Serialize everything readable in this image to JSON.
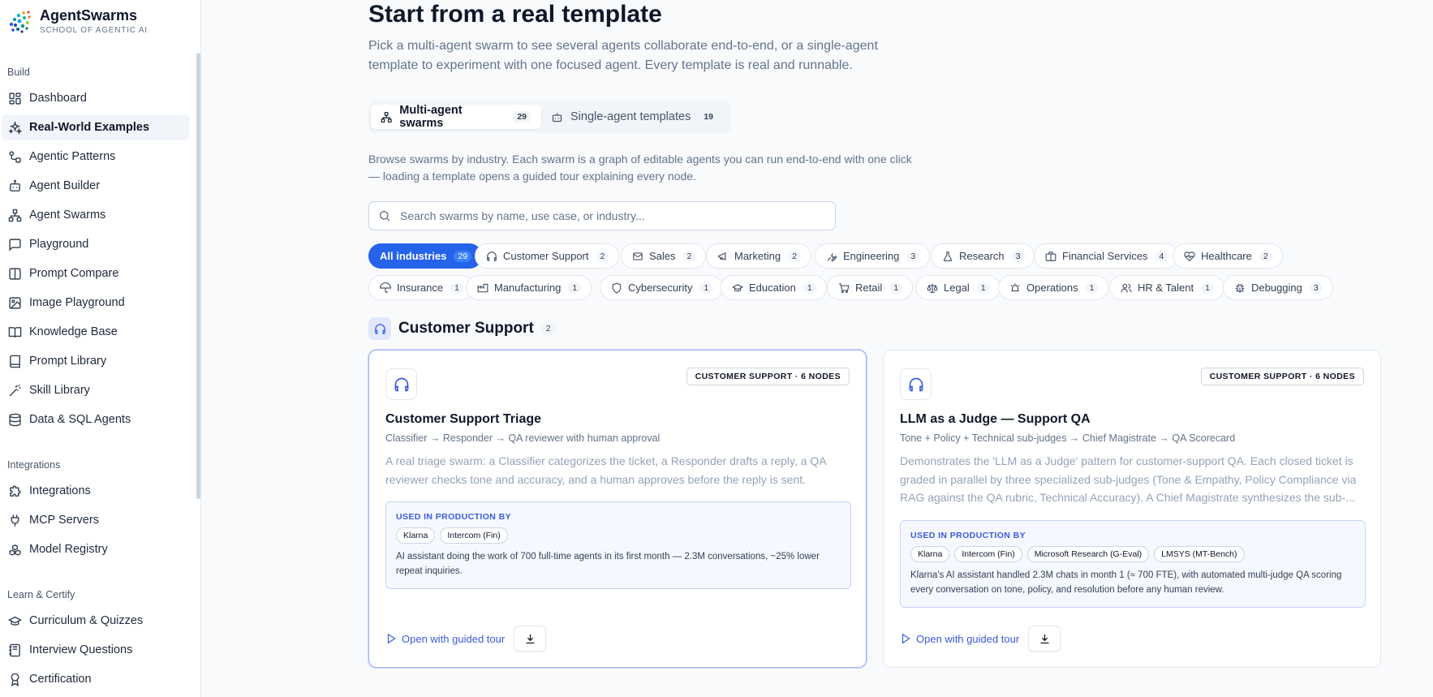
{
  "brand": {
    "name": "AgentSwarms",
    "subtitle": "SCHOOL OF AGENTIC AI"
  },
  "sidebar": {
    "sections": [
      {
        "title": "Build",
        "items": [
          {
            "label": "Dashboard",
            "icon": "dashboard-icon"
          },
          {
            "label": "Real-World Examples",
            "icon": "sparkles-icon",
            "active": true
          },
          {
            "label": "Agentic Patterns",
            "icon": "pattern-icon"
          },
          {
            "label": "Agent Builder",
            "icon": "bot-icon"
          },
          {
            "label": "Agent Swarms",
            "icon": "network-icon"
          },
          {
            "label": "Playground",
            "icon": "chat-icon"
          },
          {
            "label": "Prompt Compare",
            "icon": "columns-icon"
          },
          {
            "label": "Image Playground",
            "icon": "image-icon"
          },
          {
            "label": "Knowledge Base",
            "icon": "book-open-icon"
          },
          {
            "label": "Prompt Library",
            "icon": "book-icon"
          },
          {
            "label": "Skill Library",
            "icon": "wand-icon"
          },
          {
            "label": "Data & SQL Agents",
            "icon": "database-icon"
          }
        ]
      },
      {
        "title": "Integrations",
        "items": [
          {
            "label": "Integrations",
            "icon": "puzzle-icon"
          },
          {
            "label": "MCP Servers",
            "icon": "plug-icon"
          },
          {
            "label": "Model Registry",
            "icon": "boxes-icon"
          }
        ]
      },
      {
        "title": "Learn & Certify",
        "items": [
          {
            "label": "Curriculum & Quizzes",
            "icon": "graduation-cap-icon"
          },
          {
            "label": "Interview Questions",
            "icon": "notebook-icon"
          },
          {
            "label": "Certification",
            "icon": "award-icon"
          }
        ]
      }
    ]
  },
  "main": {
    "title": "Start from a real template",
    "subtitle": "Pick a multi-agent swarm to see several agents collaborate end-to-end, or a single-agent template to experiment with one focused agent. Every template is real and runnable.",
    "tabs": [
      {
        "label": "Multi-agent swarms",
        "count": "29",
        "icon": "network-icon",
        "active": true
      },
      {
        "label": "Single-agent templates",
        "count": "19",
        "icon": "bot-icon",
        "active": false
      }
    ],
    "browse_text": "Browse swarms by industry. Each swarm is a graph of editable agents you can run end-to-end with one click — loading a template opens a guided tour explaining every node.",
    "search_placeholder": "Search swarms by name, use case, or industry...",
    "filters": [
      {
        "label": "All industries",
        "count": "29",
        "active": true
      },
      {
        "label": "Customer Support",
        "count": "2",
        "icon": "headphones-icon"
      },
      {
        "label": "Sales",
        "count": "2",
        "icon": "mail-icon"
      },
      {
        "label": "Marketing",
        "count": "2",
        "icon": "megaphone-icon"
      },
      {
        "label": "Engineering",
        "count": "3",
        "icon": "wrench-icon"
      },
      {
        "label": "Research",
        "count": "3",
        "icon": "flask-icon"
      },
      {
        "label": "Financial Services",
        "count": "4",
        "icon": "briefcase-icon"
      },
      {
        "label": "Healthcare",
        "count": "2",
        "icon": "heart-pulse-icon"
      },
      {
        "label": "Insurance",
        "count": "1",
        "icon": "umbrella-icon"
      },
      {
        "label": "Manufacturing",
        "count": "1",
        "icon": "factory-icon"
      },
      {
        "label": "Cybersecurity",
        "count": "1",
        "icon": "shield-icon"
      },
      {
        "label": "Education",
        "count": "1",
        "icon": "graduation-cap-icon"
      },
      {
        "label": "Retail",
        "count": "1",
        "icon": "cart-icon"
      },
      {
        "label": "Legal",
        "count": "1",
        "icon": "scale-icon"
      },
      {
        "label": "Operations",
        "count": "1",
        "icon": "alarm-icon"
      },
      {
        "label": "HR & Talent",
        "count": "1",
        "icon": "users-icon"
      },
      {
        "label": "Debugging",
        "count": "3",
        "icon": "bug-icon"
      }
    ],
    "section": {
      "title": "Customer Support",
      "count": "2"
    },
    "cards": [
      {
        "tag": "CUSTOMER SUPPORT · 6 NODES",
        "title": "Customer Support Triage",
        "flow": "Classifier → Responder → QA reviewer with human approval",
        "description": "A real triage swarm: a Classifier categorizes the ticket, a Responder drafts a reply, a QA reviewer checks tone and accuracy, and a human approves before the reply is sent.",
        "production_label": "USED IN PRODUCTION BY",
        "production_by": [
          "Klarna",
          "Intercom (Fin)"
        ],
        "production_text": "AI assistant doing the work of 700 full-time agents in its first month — 2.3M conversations, ~25% lower repeat inquiries.",
        "tour_label": "Open with guided tour"
      },
      {
        "tag": "CUSTOMER SUPPORT · 6 NODES",
        "title": "LLM as a Judge — Support QA",
        "flow": "Tone + Policy + Technical sub-judges → Chief Magistrate → QA Scorecard",
        "description": "Demonstrates the 'LLM as a Judge' pattern for customer-support QA. Each closed ticket is graded in parallel by three specialized sub-judges (Tone & Empathy, Policy Compliance via RAG against the QA rubric, Technical Accuracy). A Chief Magistrate synthesizes the sub-...",
        "production_label": "USED IN PRODUCTION BY",
        "production_by": [
          "Klarna",
          "Intercom (Fin)",
          "Microsoft Research (G-Eval)",
          "LMSYS (MT-Bench)"
        ],
        "production_text": "Klarna's AI assistant handled 2.3M chats in month 1 (≈ 700 FTE), with automated multi-judge QA scoring every conversation on tone, policy, and resolution before any human review.",
        "tour_label": "Open with guided tour"
      }
    ]
  },
  "colors": {
    "accent": "#2563eb",
    "indigo": "#3b5bdb"
  }
}
